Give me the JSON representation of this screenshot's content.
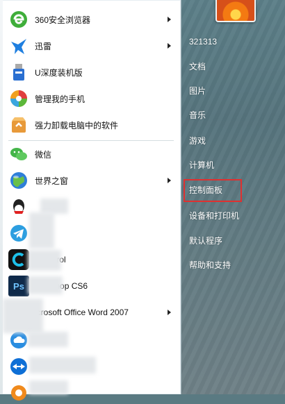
{
  "programs": [
    {
      "label": "360安全浏览器",
      "has_arrow": true,
      "icon": "360-browser-icon"
    },
    {
      "label": "迅雷",
      "has_arrow": true,
      "icon": "xunlei-icon"
    },
    {
      "label": "U深度装机版",
      "has_arrow": false,
      "icon": "usb-drive-icon"
    },
    {
      "label": "管理我的手机",
      "has_arrow": false,
      "icon": "phone-manager-icon"
    },
    {
      "label": "强力卸载电脑中的软件",
      "has_arrow": false,
      "icon": "uninstall-icon"
    },
    {
      "label": "微信",
      "has_arrow": false,
      "icon": "wechat-icon"
    },
    {
      "label": "世界之窗",
      "has_arrow": true,
      "icon": "world-window-icon"
    },
    {
      "label": "",
      "has_arrow": false,
      "icon": "qq-icon"
    },
    {
      "label": "",
      "has_arrow": false,
      "icon": "telegram-icon"
    },
    {
      "label": "l Control",
      "has_arrow": false,
      "icon": "control-app-icon"
    },
    {
      "label": "hotoshop CS6",
      "has_arrow": false,
      "icon": "photoshop-icon"
    },
    {
      "label": "icrosoft Office Word 2007",
      "has_arrow": true,
      "icon": "word-icon"
    },
    {
      "label": "",
      "has_arrow": false,
      "icon": "cloud-icon"
    },
    {
      "label": "",
      "has_arrow": false,
      "icon": "teamviewer-icon"
    },
    {
      "label": "",
      "has_arrow": false,
      "icon": "media-icon"
    }
  ],
  "photoshop_badge": "Ps",
  "right_menu": {
    "user_name": "321313",
    "items": [
      "文档",
      "图片",
      "音乐",
      "游戏",
      "计算机",
      "控制面板",
      "设备和打印机",
      "默认程序",
      "帮助和支持"
    ],
    "highlighted": "控制面板"
  },
  "colors": {
    "highlight_border": "#e03030",
    "right_pane": "#5c7f88"
  }
}
